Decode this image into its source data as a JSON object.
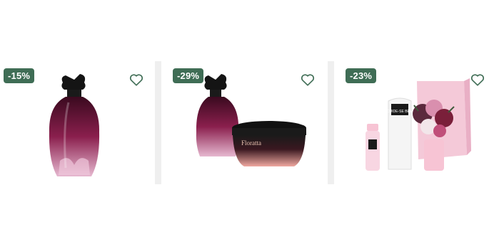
{
  "products": [
    {
      "discount": "-15%",
      "favorite_icon": "heart-outline-icon"
    },
    {
      "discount": "-29%",
      "favorite_icon": "heart-outline-icon"
    },
    {
      "discount": "-23%",
      "favorite_icon": "heart-outline-icon"
    }
  ],
  "product_images": {
    "jar_brand": "Floratta",
    "kit_brand": "CUIDE-SE BEM"
  },
  "colors": {
    "badge_bg": "#3f6d55",
    "heart": "#3f6d55",
    "divider": "#efefef",
    "perfume": "#8a1f4d"
  }
}
